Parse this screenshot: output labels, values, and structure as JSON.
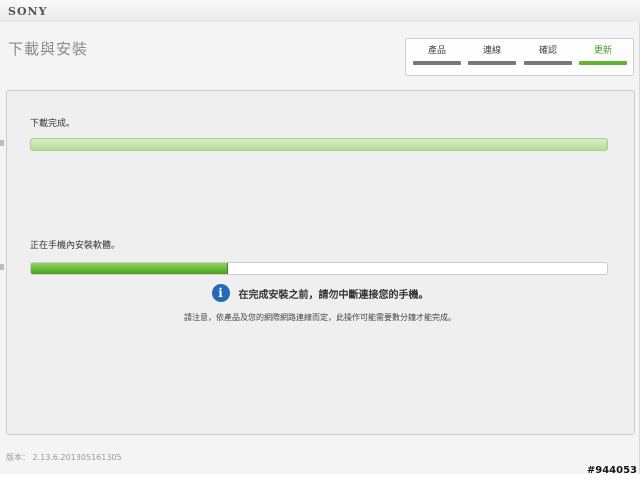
{
  "brand": "SONY",
  "page_title": "下載與安裝",
  "steps": [
    {
      "label": "產品",
      "active": false
    },
    {
      "label": "連線",
      "active": false
    },
    {
      "label": "確認",
      "active": false
    },
    {
      "label": "更新",
      "active": true
    }
  ],
  "download": {
    "label": "下載完成。",
    "progress": 1.0
  },
  "install": {
    "label": "正在手機內安裝軟體。",
    "progress": 0.34
  },
  "warning": {
    "icon": "info-icon",
    "icon_glyph": "i",
    "text": "在完成安裝之前，請勿中斷連接您的手機。"
  },
  "note": "請注意，依產品及您的網際網路連線而定，此操作可能需要數分鐘才能完成。",
  "version": "版本： 2.13.6.201305161305",
  "watermark": "#944053",
  "colors": {
    "accent": "#62b22e",
    "info": "#2468b8"
  }
}
